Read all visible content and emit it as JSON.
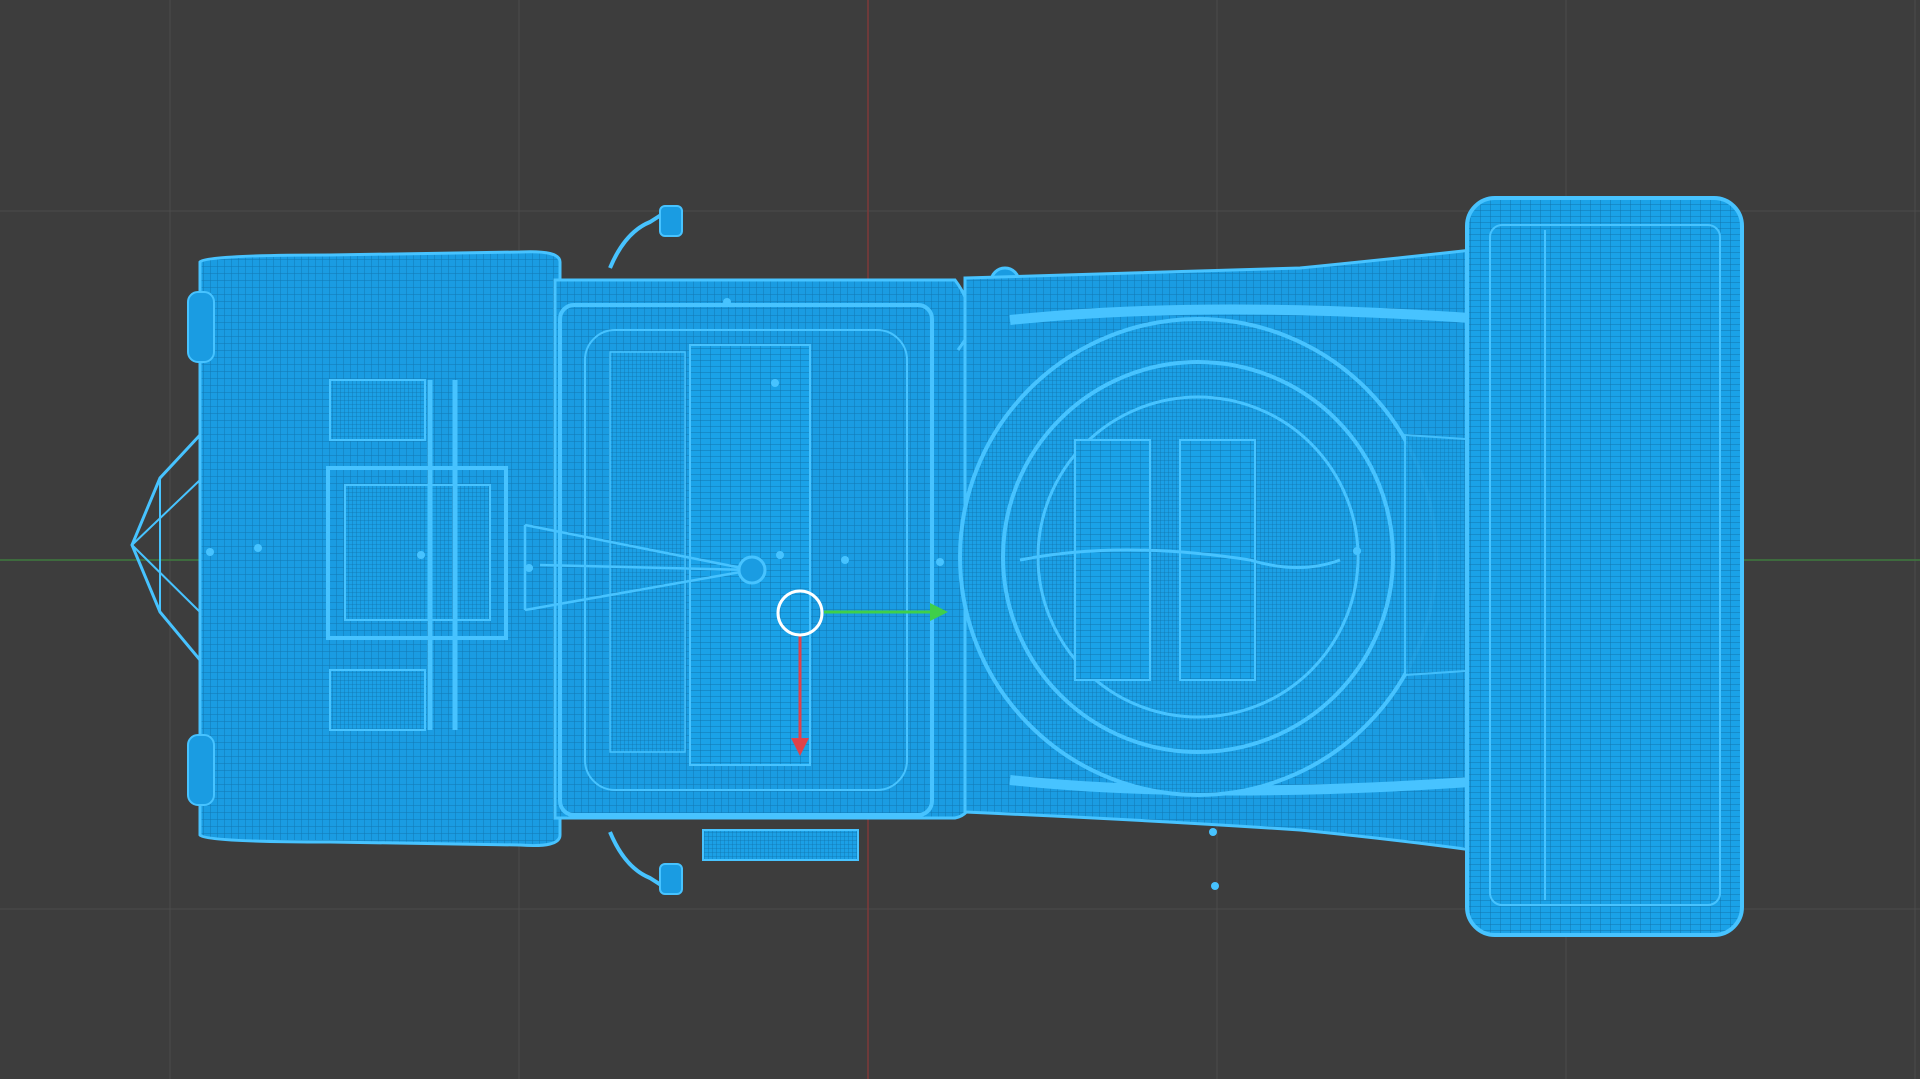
{
  "viewport": {
    "view": "top-orthographic",
    "background_color": "#3d3d3d",
    "grid_color": "#4a4a4a",
    "x_axis_color": "#7a3a3a",
    "y_axis_color": "#3e7a3e",
    "shading": "wireframe"
  },
  "model": {
    "description_icon": "vehicle-wireframe",
    "wire_color": "#1ea8ec",
    "fill_color": "#178fd0",
    "highlight_color": "#47c3ff"
  },
  "gizmo": {
    "type": "transform-gizmo",
    "pivot_icon": "origin-circle-icon",
    "x_arrow_color": "#e0424a",
    "y_arrow_color": "#3fcf4a",
    "pivot_color": "#ffffff"
  }
}
